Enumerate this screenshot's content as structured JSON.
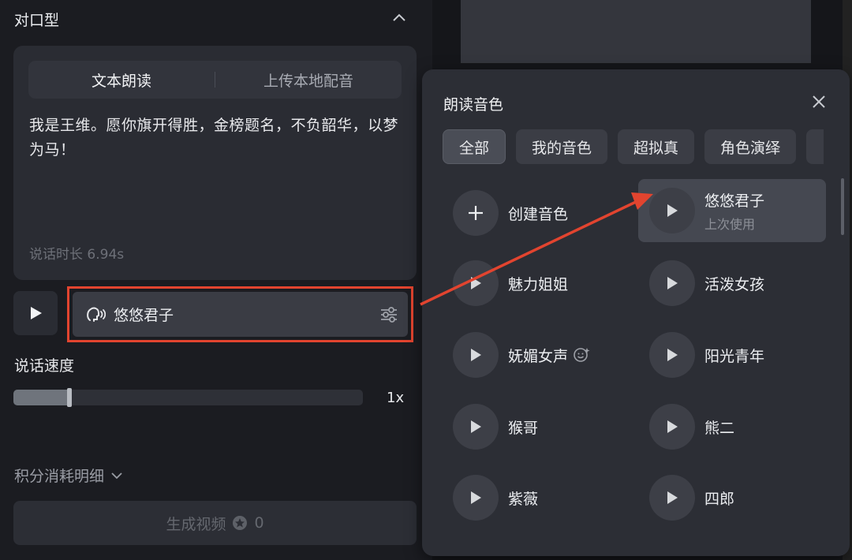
{
  "left": {
    "section_title": "对口型",
    "tabs": [
      {
        "label": "文本朗读",
        "active": true
      },
      {
        "label": "上传本地配音",
        "active": false
      }
    ],
    "script_text": "我是王维。愿你旗开得胜，金榜题名，不负韶华，以梦为马！",
    "duration": "说话时长 6.94s",
    "selected_voice": "悠悠君子",
    "speed_label": "说话速度",
    "speed_value": "1x",
    "speed_level_fraction": 0.16,
    "cost_label": "积分消耗明细",
    "generate_label": "生成视频",
    "generate_cost": "0"
  },
  "popover": {
    "title": "朗读音色",
    "filters": [
      {
        "label": "全部",
        "active": true
      },
      {
        "label": "我的音色",
        "active": false
      },
      {
        "label": "超拟真",
        "active": false
      },
      {
        "label": "角色演绎",
        "active": false
      }
    ],
    "create_label": "创建音色",
    "voices": [
      {
        "label": "悠悠君子",
        "sub": "上次使用",
        "selected": true
      },
      {
        "label": "魅力姐姐"
      },
      {
        "label": "活泼女孩"
      },
      {
        "label": "妩媚女声",
        "badge_icon": "smile-sparkle-icon"
      },
      {
        "label": "阳光青年"
      },
      {
        "label": "猴哥"
      },
      {
        "label": "熊二"
      },
      {
        "label": "紫薇"
      },
      {
        "label": "四郎"
      }
    ]
  },
  "colors": {
    "highlight_border": "#e2442f",
    "arrow": "#e2442f",
    "panel_bg": "#2c2e35"
  }
}
